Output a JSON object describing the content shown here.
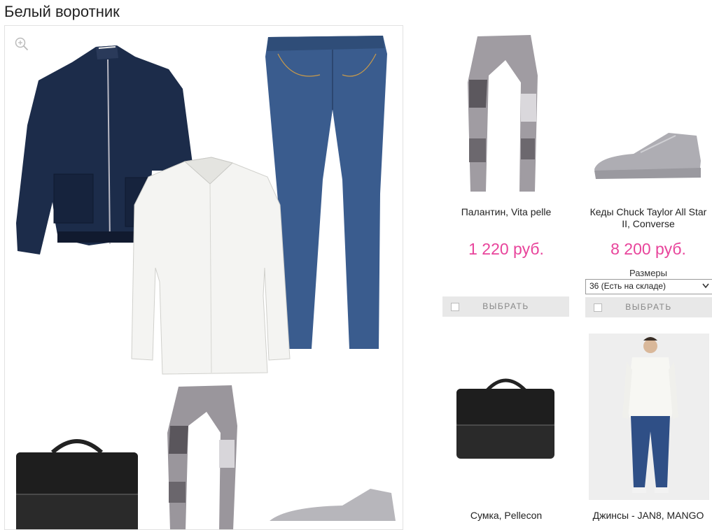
{
  "page": {
    "title": "Белый воротник"
  },
  "products": [
    {
      "name": "Палантин, Vita pelle",
      "price": "1 220 руб.",
      "button": "ВЫБРАТЬ"
    },
    {
      "name": "Кеды Chuck Taylor All Star II, Converse",
      "price": "8 200 руб.",
      "sizes_label": "Размеры",
      "size_selected": "36 (Есть на складе)",
      "button": "ВЫБРАТЬ"
    },
    {
      "name": "Сумка, Pellecon"
    },
    {
      "name": "Джинсы - JAN8, MANGO"
    }
  ],
  "colors": {
    "price": "#e8449b",
    "button_bg": "#e8e8e8"
  },
  "icons": [
    "zoom-in-icon",
    "checkbox-icon",
    "chevron-down-icon"
  ]
}
